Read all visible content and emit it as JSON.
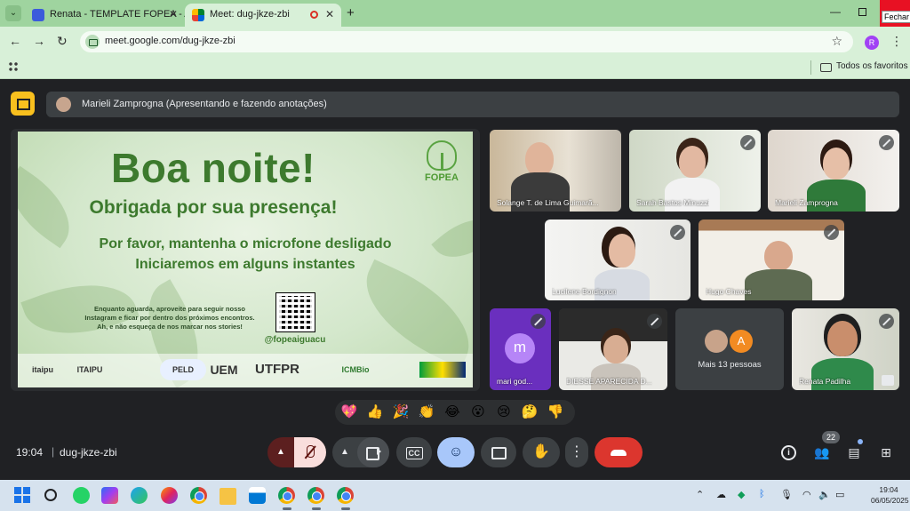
{
  "browser": {
    "tabs": [
      {
        "title": "Renata - TEMPLATE FOPEA - Ap",
        "active": false
      },
      {
        "title": "Meet: dug-jkze-zbi",
        "active": true,
        "recording": true
      }
    ],
    "url": "meet.google.com/dug-jkze-zbi",
    "profile_initial": "R",
    "close_tooltip": "Fechar",
    "bookmarks_folder": "Todos os favoritos"
  },
  "meet": {
    "presenter_banner": "Marieli Zamprogna (Apresentando e fazendo anotações)",
    "slide": {
      "title": "Boa noite!",
      "subtitle": "Obrigada por sua presença!",
      "line1": "Por favor,  mantenha o microfone desligado",
      "line2": "Iniciaremos em alguns instantes",
      "small1": "Enquanto aguarda, aproveite para seguir nosso",
      "small2": "Instagram e ficar por dentro dos próximos encontros.",
      "small3": "Ah, e não esqueça de nos marcar nos stories!",
      "handle": "@fopeaiguacu",
      "logo_text": "FOPEA",
      "partner_logos": [
        "itaipu parquetec",
        "ITAIPU",
        "PELD IGUAÇU",
        "UEM",
        "UTFPR",
        "ICMBio"
      ]
    },
    "participants": [
      {
        "name": "Solange T. de Lima Guimarã...",
        "muted": false
      },
      {
        "name": "Sarah Bastos Minuzzi",
        "muted": true
      },
      {
        "name": "Marieli Zamprogna",
        "muted": true
      },
      {
        "name": "Lucilene Bordignon",
        "muted": true
      },
      {
        "name": "Hugo Chaves",
        "muted": true
      },
      {
        "name": "mari god...",
        "muted": true,
        "avatar_letter": "m"
      },
      {
        "name": "DIESSE APARECIDA D...",
        "muted": true
      },
      {
        "name": "Renata Padilha",
        "muted": true
      }
    ],
    "more_people": {
      "label": "Mais 13 pessoas",
      "avatar_letter": "A"
    },
    "reactions": [
      "💖",
      "👍",
      "🎉",
      "👏",
      "😂",
      "😮",
      "😢",
      "🤔",
      "👎"
    ],
    "time": "19:04",
    "meeting_code": "dug-jkze-zbi",
    "people_count": "22"
  },
  "taskbar": {
    "clock_time": "19:04",
    "clock_date": "06/05/2025"
  },
  "colors": {
    "browser_frame": "#9fd49f",
    "meet_bg": "#202124",
    "leave_red": "#dc362e",
    "slide_green": "#3d7a2e"
  }
}
